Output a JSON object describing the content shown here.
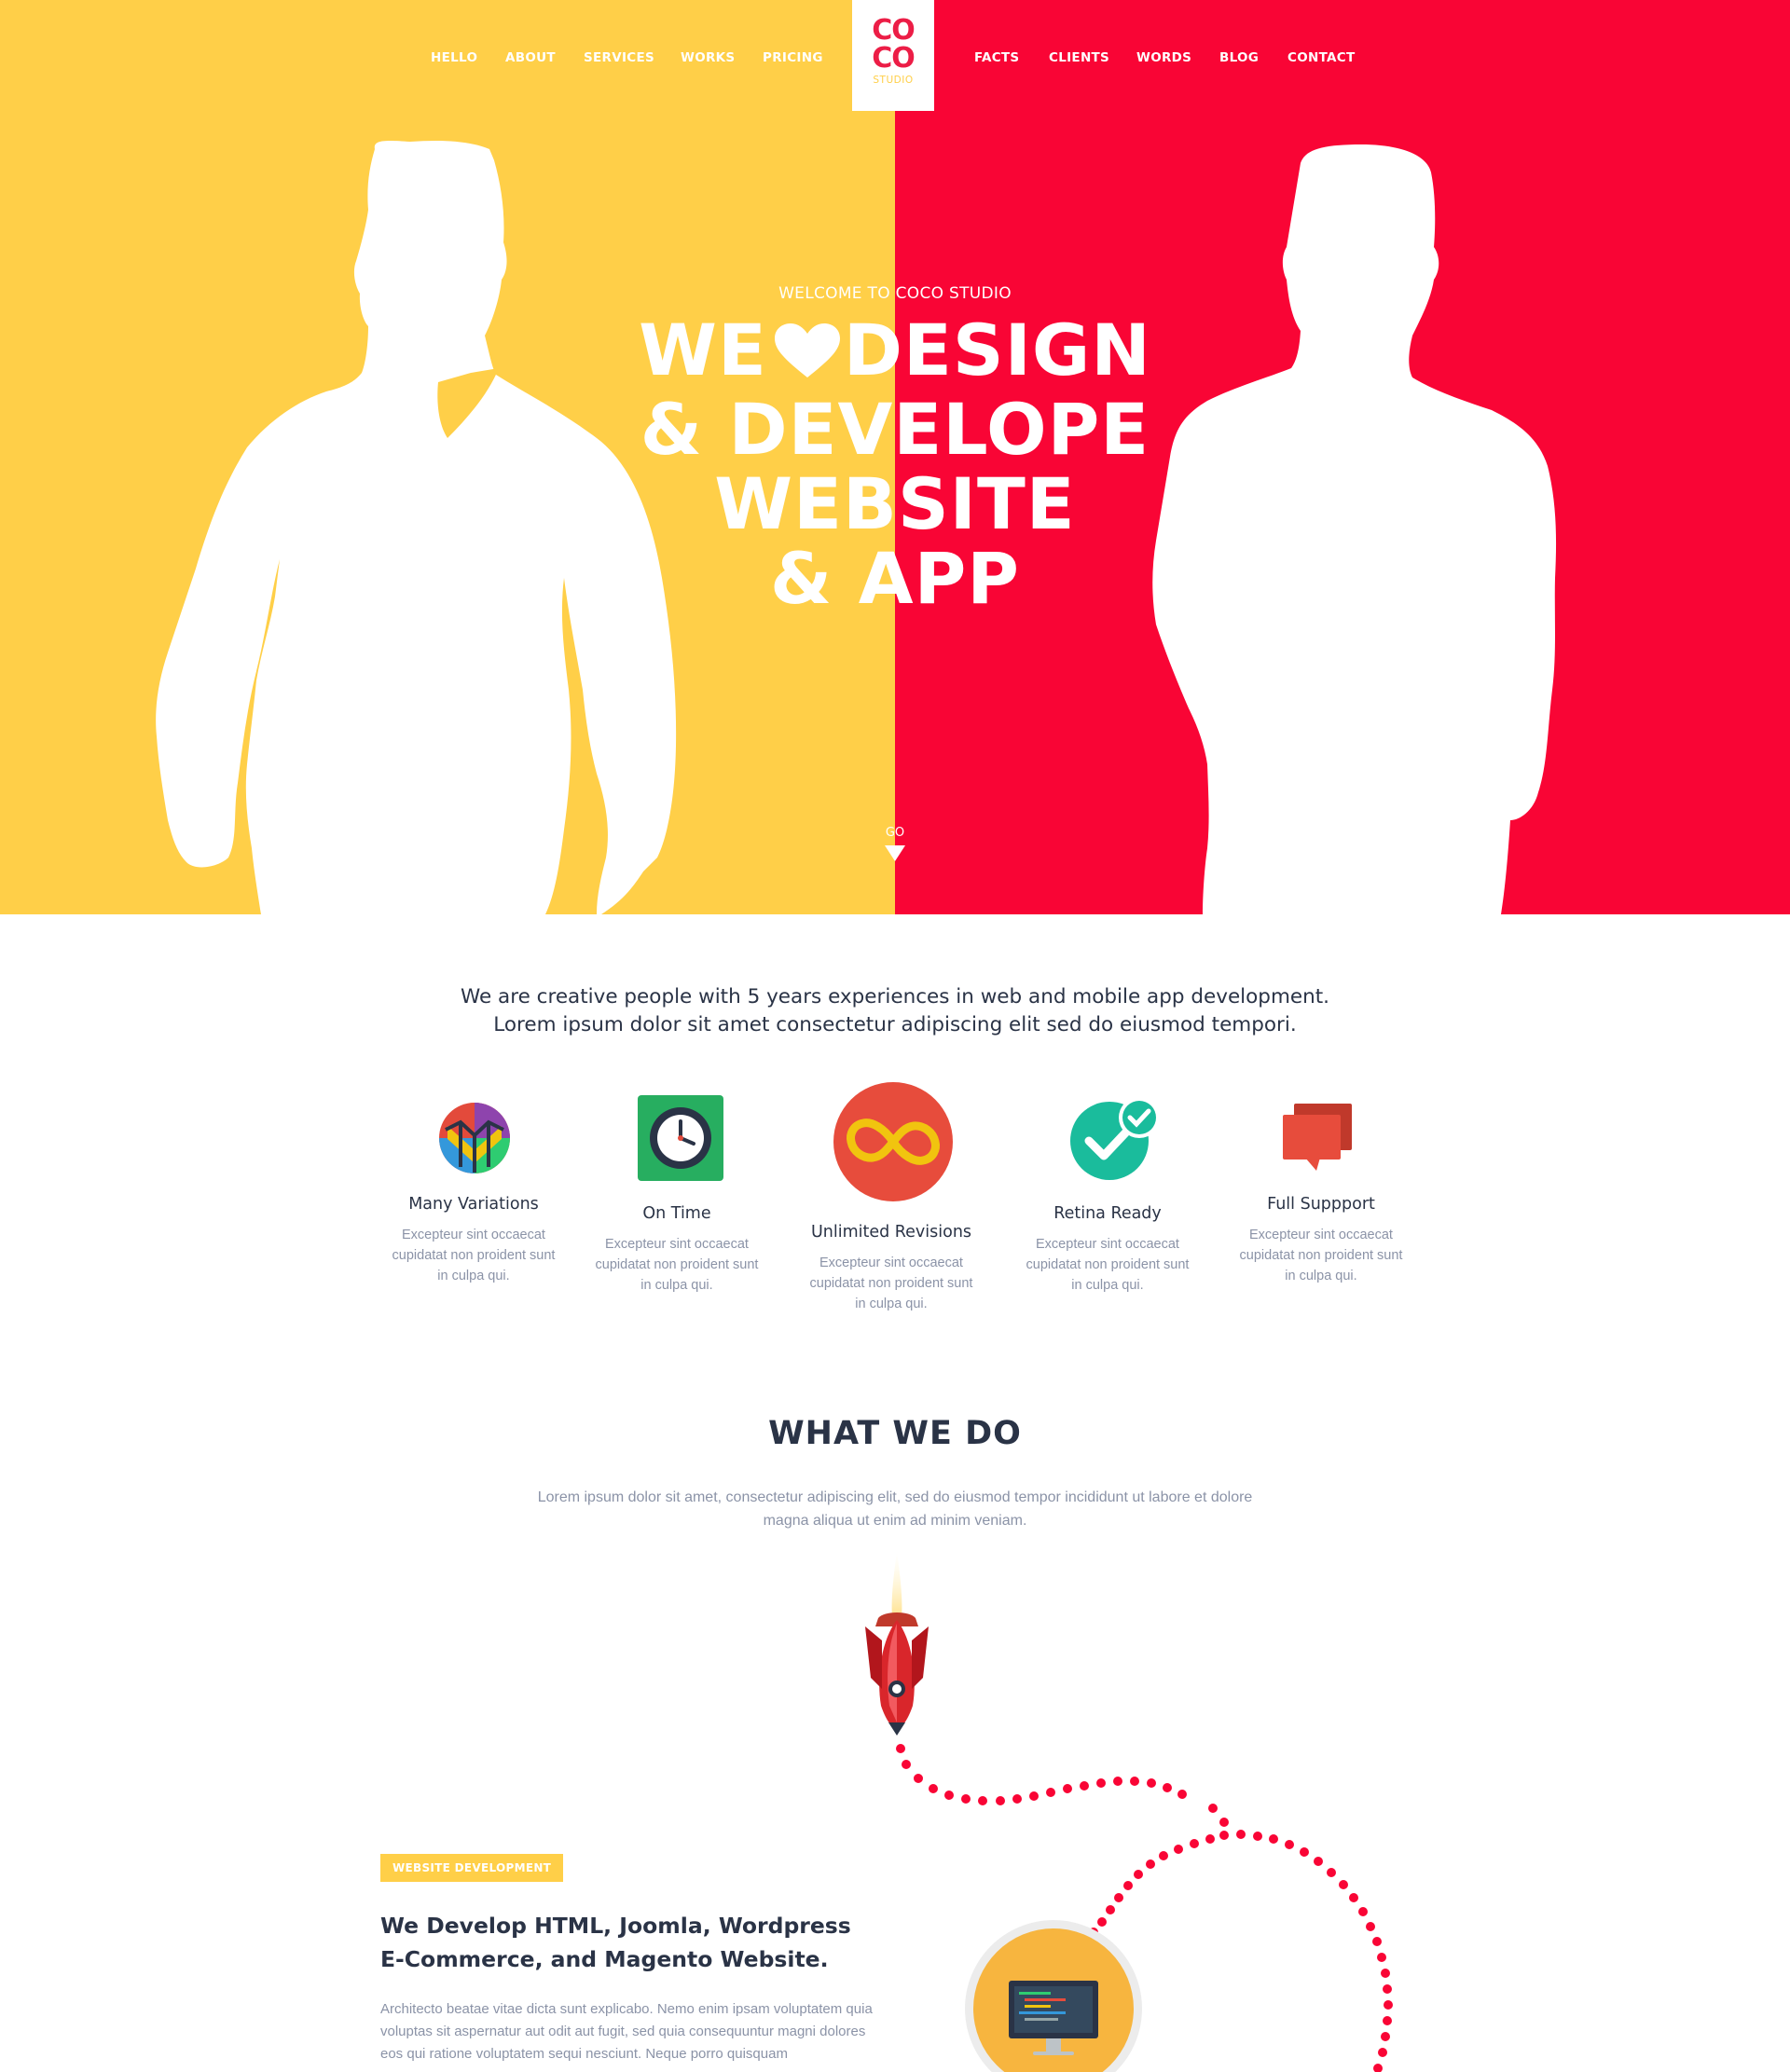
{
  "nav": {
    "left": [
      "HELLO",
      "ABOUT",
      "SERVICES",
      "WORKS",
      "PRICING"
    ],
    "right": [
      "FACTS",
      "CLIENTS",
      "WORDS",
      "BLOG",
      "CONTACT"
    ],
    "logo": {
      "line1": "CO",
      "line2": "CO",
      "sub": "STUDIO"
    }
  },
  "colors": {
    "yellow": "#ffcf48",
    "red": "#f90535",
    "navy": "#2a3346",
    "muted": "#8b93a7"
  },
  "hero": {
    "welcome": "WELCOME TO COCO STUDIO",
    "line1_a": "WE",
    "line1_b": "DESIGN",
    "line2": "& DEVELOPE",
    "line3": "WEBSITE",
    "line4": "& APP",
    "go": "GO"
  },
  "intro": {
    "line1": "We are creative people with 5 years experiences  in web  and mobile app development.",
    "line2": "Lorem ipsum dolor sit amet consectetur adipiscing elit sed do eiusmod tempori."
  },
  "features": [
    {
      "icon": "variations-icon",
      "title": "Many Variations",
      "desc": "Excepteur sint occaecat cupidatat non proident sunt in culpa qui."
    },
    {
      "icon": "clock-icon",
      "title": "On Time",
      "desc": "Excepteur sint occaecat cupidatat non proident sunt in culpa qui."
    },
    {
      "icon": "infinity-icon",
      "title": "Unlimited Revisions",
      "desc": "Excepteur sint occaecat cupidatat non proident sunt in culpa qui."
    },
    {
      "icon": "checkmark-icon",
      "title": "Retina Ready",
      "desc": "Excepteur sint occaecat cupidatat non proident sunt in culpa qui."
    },
    {
      "icon": "chat-icon",
      "title": "Full Suppport",
      "desc": "Excepteur sint occaecat cupidatat non proident sunt in culpa qui."
    }
  ],
  "what_we_do": {
    "title": "WHAT WE DO",
    "subtitle": "Lorem ipsum dolor sit amet, consectetur adipiscing elit, sed do eiusmod tempor incididunt ut labore et dolore magna aliqua ut enim ad minim veniam."
  },
  "web_dev": {
    "badge": "WEBSITE DEVELOPMENT",
    "title_line1": "We Develop HTML, Joomla, Wordpress",
    "title_line2": "E-Commerce, and Magento Website.",
    "body": "Architecto beatae vitae dicta sunt explicabo. Nemo enim ipsam voluptatem quia voluptas sit aspernatur aut odit aut fugit, sed quia consequuntur magni dolores eos qui ratione voluptatem sequi nesciunt. Neque porro quisquam"
  }
}
